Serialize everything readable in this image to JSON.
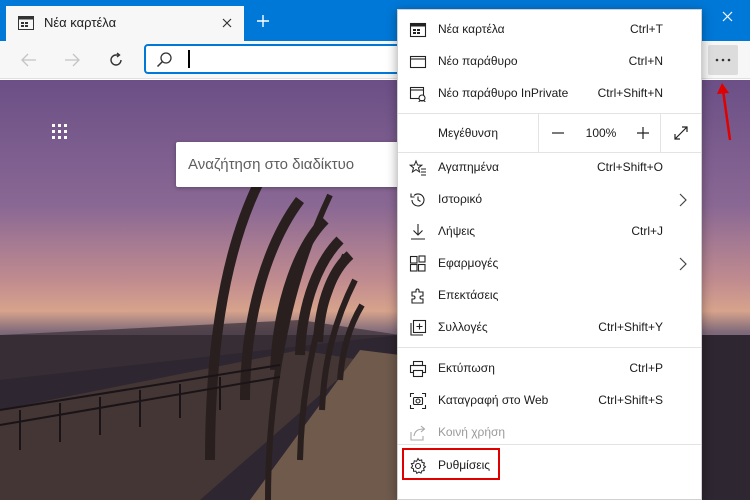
{
  "tab": {
    "title": "Νέα καρτέλα"
  },
  "search": {
    "placeholder": "Αναζήτηση στο διαδίκτυο"
  },
  "menu": {
    "new_tab": {
      "label": "Νέα καρτέλα",
      "shortcut": "Ctrl+T"
    },
    "new_window": {
      "label": "Νέο παράθυρο",
      "shortcut": "Ctrl+N"
    },
    "new_inprivate": {
      "label": "Νέο παράθυρο InPrivate",
      "shortcut": "Ctrl+Shift+N"
    },
    "zoom": {
      "label": "Μεγέθυνση",
      "value": "100%"
    },
    "favorites": {
      "label": "Αγαπημένα",
      "shortcut": "Ctrl+Shift+O"
    },
    "history": {
      "label": "Ιστορικό"
    },
    "downloads": {
      "label": "Λήψεις",
      "shortcut": "Ctrl+J"
    },
    "apps": {
      "label": "Εφαρμογές"
    },
    "extensions": {
      "label": "Επεκτάσεις"
    },
    "collections": {
      "label": "Συλλογές",
      "shortcut": "Ctrl+Shift+Y"
    },
    "print": {
      "label": "Εκτύπωση",
      "shortcut": "Ctrl+P"
    },
    "web_capture": {
      "label": "Καταγραφή στο Web",
      "shortcut": "Ctrl+Shift+S"
    },
    "share": {
      "label": "Κοινή χρήση"
    },
    "settings": {
      "label": "Ρυθμίσεις"
    }
  },
  "colors": {
    "titlebar": "#0078d7",
    "highlight": "#e10000"
  }
}
